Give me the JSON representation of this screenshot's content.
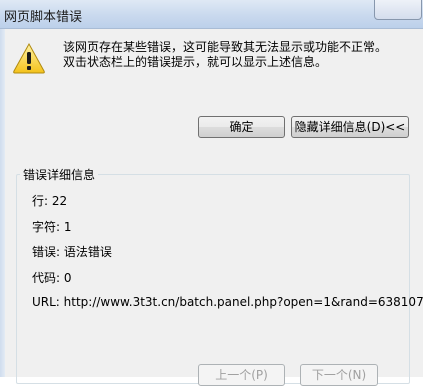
{
  "window": {
    "title": "网页脚本错误"
  },
  "message": {
    "line1": "该网页存在某些错误，这可能导致其无法显示或功能不正常。",
    "line2": "双击状态栏上的错误提示，就可以显示上述信息。"
  },
  "buttons": {
    "ok": "确定",
    "hide_details": "隐藏详细信息(D)<<",
    "prev": "上一个(P)",
    "next": "下一个(N)"
  },
  "details": {
    "group_title": "错误详细信息",
    "line": "行: 22",
    "char": "字符: 1",
    "error": "错误: 语法错误",
    "code": "代码: 0",
    "url": "URL: http://www.3t3t.cn/batch.panel.php?open=1&rand=638107"
  },
  "icons": {
    "warning": "warning-icon",
    "close": "close-icon"
  }
}
